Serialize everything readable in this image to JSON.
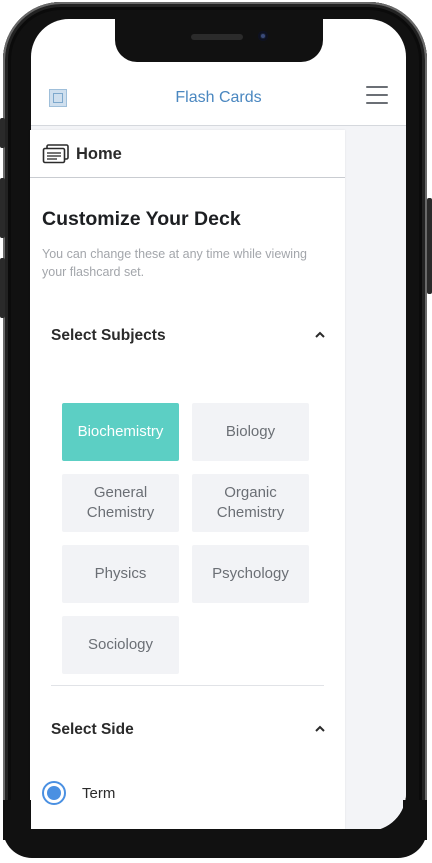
{
  "header": {
    "title": "Flash Cards",
    "logo_icon": "logo-icon",
    "menu_icon": "hamburger-menu-icon"
  },
  "breadcrumb": {
    "icon": "flashcards-icon",
    "label": "Home"
  },
  "page": {
    "title": "Customize Your Deck",
    "description": "You can change these at any time while viewing your flashcard set."
  },
  "subjects": {
    "label": "Select Subjects",
    "expanded": true,
    "items": [
      {
        "label": "Biochemistry",
        "selected": true
      },
      {
        "label": "Biology",
        "selected": false
      },
      {
        "label": "General Chemistry",
        "selected": false
      },
      {
        "label": "Organic Chemistry",
        "selected": false
      },
      {
        "label": "Physics",
        "selected": false
      },
      {
        "label": "Psychology",
        "selected": false
      },
      {
        "label": "Sociology",
        "selected": false
      }
    ]
  },
  "side": {
    "label": "Select Side",
    "expanded": true,
    "options": [
      {
        "label": "Term",
        "selected": true
      }
    ]
  },
  "colors": {
    "accent": "#5ccfc4",
    "link": "#4a87c0",
    "radio": "#4a90e2"
  }
}
